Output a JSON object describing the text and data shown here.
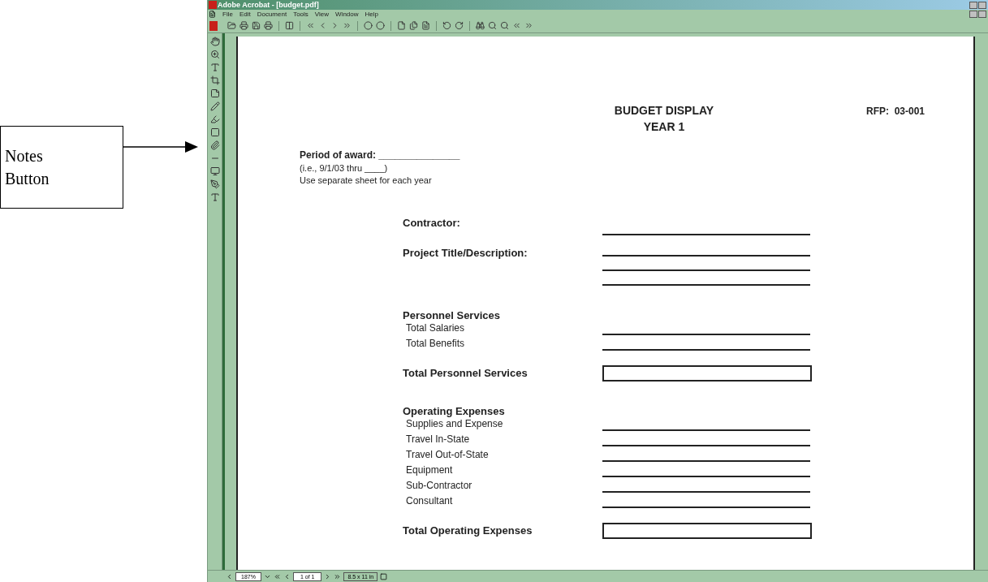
{
  "callout": {
    "label": "Notes Button"
  },
  "window": {
    "title": "Adobe Acrobat - [budget.pdf]"
  },
  "menu": [
    "File",
    "Edit",
    "Document",
    "Tools",
    "View",
    "Window",
    "Help"
  ],
  "document": {
    "title": "BUDGET DISPLAY",
    "subtitle": "YEAR 1",
    "rfp": "RFP:  03-001",
    "period": "Period of award: _______________",
    "notes": [
      "(i.e., 9/1/03 thru ____)",
      "Use separate sheet for each year"
    ],
    "rows": [
      {
        "kind": "field",
        "label": "Contractor:"
      },
      {
        "kind": "multi",
        "label": "Project Title/Description:"
      },
      {
        "kind": "section",
        "label": "Personnel Services"
      },
      {
        "kind": "item",
        "label": "Total Salaries"
      },
      {
        "kind": "item",
        "label": "Total Benefits"
      },
      {
        "kind": "total",
        "label": "Total Personnel Services"
      },
      {
        "kind": "section",
        "label": "Operating Expenses"
      },
      {
        "kind": "item",
        "label": "Supplies and Expense"
      },
      {
        "kind": "item",
        "label": "Travel In-State"
      },
      {
        "kind": "item",
        "label": "Travel Out-of-State"
      },
      {
        "kind": "item",
        "label": "Equipment"
      },
      {
        "kind": "item",
        "label": "Sub-Contractor"
      },
      {
        "kind": "item",
        "label": "Consultant"
      },
      {
        "kind": "total",
        "label": "Total Operating Expenses"
      }
    ]
  },
  "status_bar": {
    "zoom": "187%",
    "page": "1 of 1",
    "size": "8.5 x 11 in"
  }
}
